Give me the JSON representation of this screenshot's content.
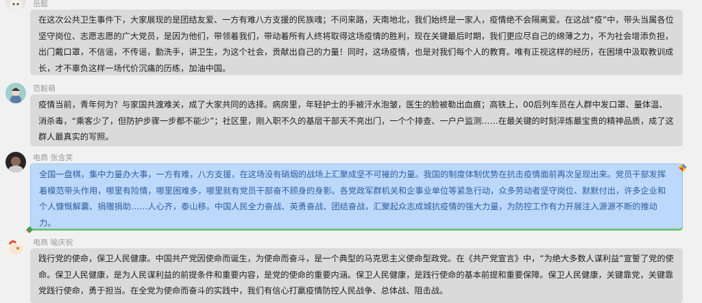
{
  "messages": [
    {
      "sender": "岳懿",
      "text": "在这次公共卫生事件下，大家展现的是团结友爱、一方有难八方支援的民族魂；不问来路，天南地北，我们始终是一家人，疫情绝不会隔离爱。在这战“疫”中，带头当属各位坚守岗位、志愿志愿的广大党员，是因为他们，带领着我们，带动着所有人终将取得这场疫情的胜利，现在关键最后时期，我们更应尽自己的绵薄之力，不为社会增添负担，出门戴口罩，不信谣，不传谣，勤洗手，讲卫生，为这个社会，贡献出自己的力量！同时，这场疫情，也是对我们每个人的教育。唯有正视这样的经历，在困境中汲取教训成长，才不辜负这样一场代价沉痛的历练，加油中国。"
    },
    {
      "sender": "范毅萌",
      "text": "疫情当前，青年何为？与家国共渡难关，成了大家共同的选择。病房里，年轻护士的手被汗水泡皱，医生的脸被勒出血痕；高铁上，00后列车员在人群中发口罩、量体温、消杀毒，“乘客少了，但防护步骤一步都不能少”；社区里，刚入职不久的基层干部天不亮出门，一个个排查、一户户监测……在最关键的时刻淬炼最宝贵的精神品质，成了这群人最真实的写照。"
    },
    {
      "sender": "电商 张含笑",
      "text": "全国一盘棋，集中力量办大事，一方有难，八方支援，在这场没有硝烟的战场上汇聚成坚不可摧的力量。我国的制度体制优势在抗击疫情面前再次呈现出来。党员干部发挥着模范带头作用，哪里有险情，哪里困难多，哪里就有党员干部奋不顾身的身影。各党政军群机关和企事业单位等紧急行动，众多劳动者坚守岗位、默默付出，许多企业和个人慷慨解囊、捐赠捐助……人心齐，泰山移。中国人民全力奋战、英勇奋战、团结奋战，汇聚起众志成城抗疫情的强大力量，为防控工作有力开展注入源源不断的推动力。"
    },
    {
      "sender": "电商 喻庆祝",
      "text": "践行党的使命，保卫人民健康。中国共产党因使命而诞生，为使命而奋斗，是一个典型的马克思主义使命型政党。在《共产党宣言》中，“为绝大多数人谋利益”宣誓了党的使命。保卫人民健康，是为人民谋利益的前提条件和重要内容，是党的使命的重要内涵。保卫人民健康，是践行使命的基本前提和重要保障。保卫人民健康，关键靠党，关键靠党践行使命，勇于担当。在全党为使命而奋斗的实践中，我们有信心打赢疫情防控人民战争、总体战、阻击战。"
    }
  ]
}
